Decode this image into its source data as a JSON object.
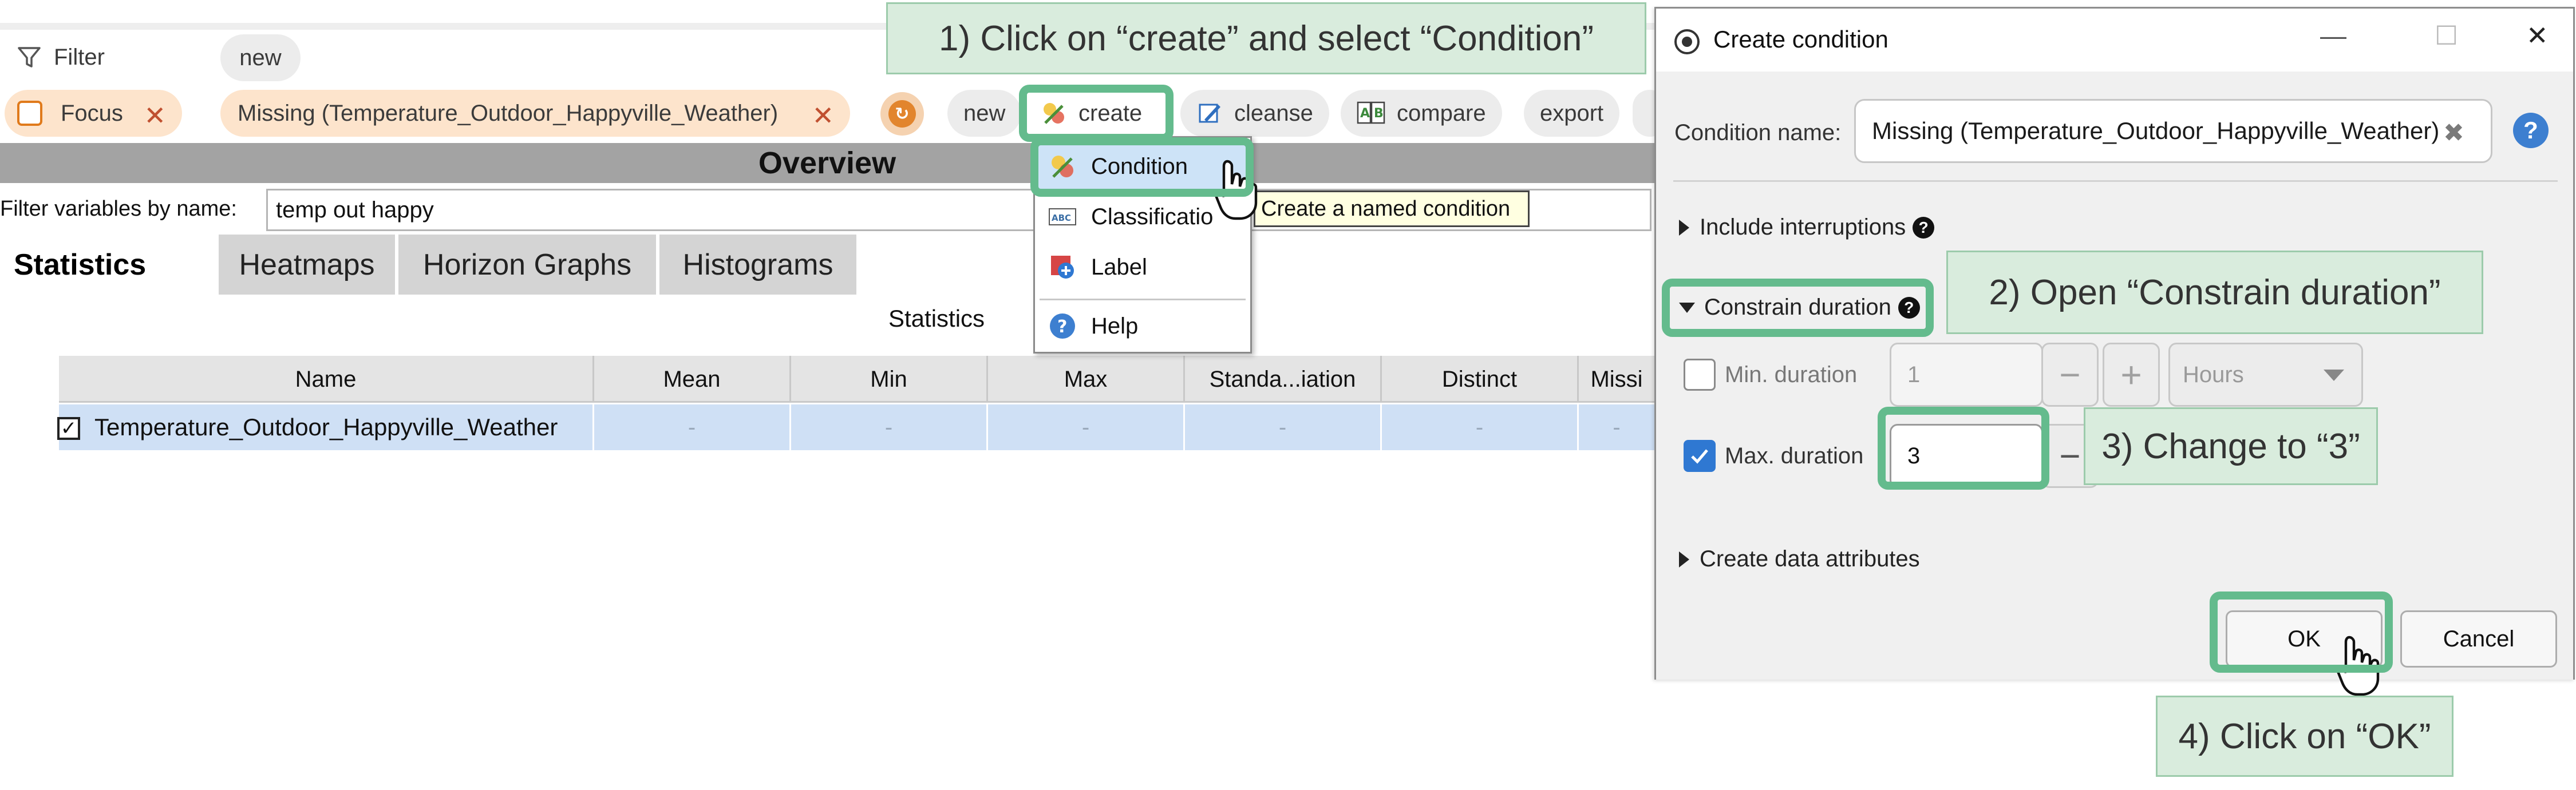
{
  "app": {
    "filter_label": "Filter",
    "filter_new_label": "new",
    "chips": [
      {
        "label": "Focus"
      },
      {
        "label": "Missing (Temperature_Outdoor_Happyville_Weather)"
      }
    ],
    "toolbar": {
      "new_label": "new",
      "create_label": "create",
      "cleanse_label": "cleanse",
      "compare_label": "compare",
      "export_label": "export"
    },
    "overview_title": "Overview",
    "name_filter": {
      "label": "Filter variables by name:",
      "value": "temp out happy"
    },
    "tabs": [
      {
        "label": "Statistics",
        "active": true
      },
      {
        "label": "Heatmaps",
        "active": false
      },
      {
        "label": "Horizon Graphs",
        "active": false
      },
      {
        "label": "Histograms",
        "active": false
      }
    ],
    "statistics_title": "Statistics",
    "table": {
      "columns": [
        "Name",
        "Mean",
        "Min",
        "Max",
        "Standa...iation",
        "Distinct",
        "Missi"
      ],
      "rows": [
        {
          "checked": true,
          "cells": [
            "Temperature_Outdoor_Happyville_Weather",
            "-",
            "-",
            "-",
            "-",
            "-",
            "-"
          ]
        }
      ]
    }
  },
  "create_menu": {
    "items": [
      {
        "label": "Condition",
        "icon": "condition-icon",
        "highlighted": true
      },
      {
        "label": "Classificatio",
        "icon": "classification-icon"
      },
      {
        "label": "Label",
        "icon": "label-icon"
      },
      {
        "label": "Help",
        "icon": "help-icon"
      }
    ],
    "tooltip": "Create a named condition"
  },
  "dialog": {
    "title": "Create condition",
    "condition_name_label": "Condition name:",
    "condition_name_value": "Missing (Temperature_Outdoor_Happyville_Weather)",
    "include_interruptions_label": "Include interruptions",
    "constrain_duration_label": "Constrain duration",
    "min_duration": {
      "label": "Min. duration",
      "checked": false,
      "value": "1",
      "unit": "Hours"
    },
    "max_duration": {
      "label": "Max. duration",
      "checked": true,
      "value": "3"
    },
    "create_attributes_label": "Create data attributes",
    "ok_label": "OK",
    "cancel_label": "Cancel"
  },
  "annotations": {
    "step1": "1) Click on “create” and select “Condition”",
    "step2": "2) Open “Constrain duration”",
    "step3": "3) Change to “3”",
    "step4": "4) Click on “OK”"
  },
  "colors": {
    "highlight_green": "#64bb8d",
    "callout_bg": "#d9ecdd",
    "chip_orange": "#fde4cc",
    "checkbox_blue": "#2f78d2",
    "overview_gray": "#a3a3a3",
    "row_selection": "#cfe0f5"
  }
}
